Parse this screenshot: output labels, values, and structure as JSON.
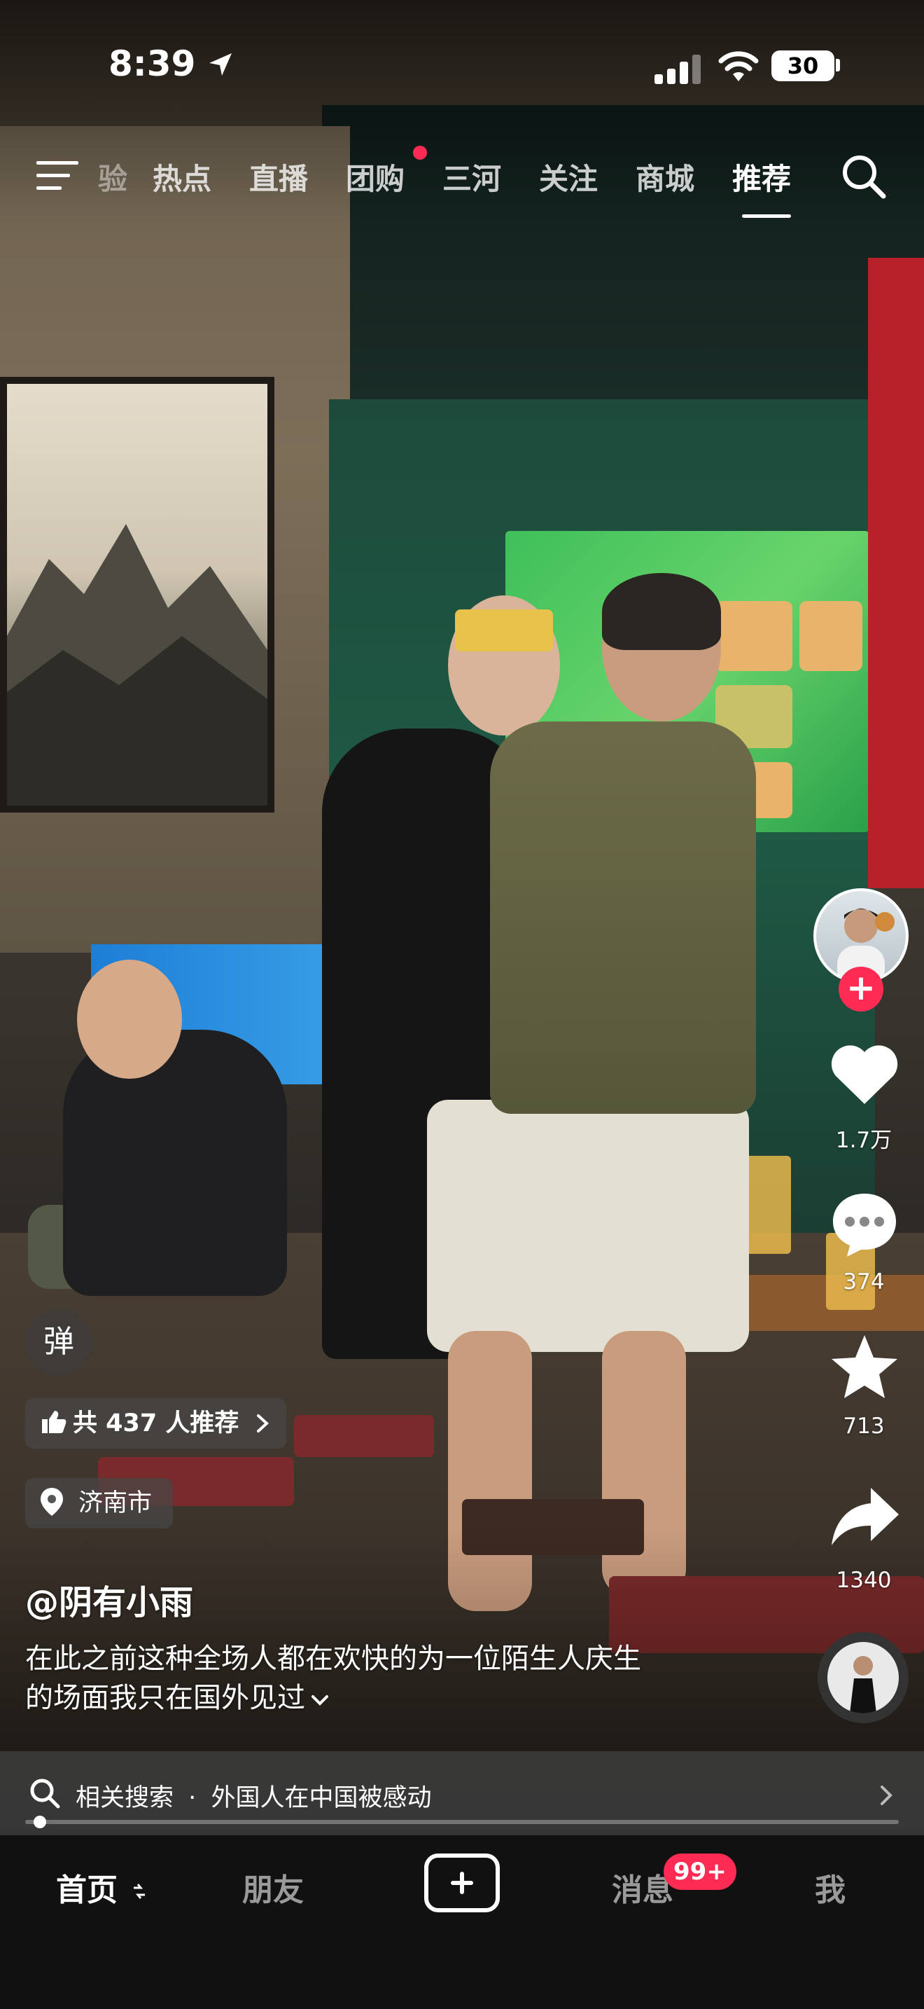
{
  "status_bar": {
    "time": "8:39",
    "battery": "30"
  },
  "top_nav": {
    "items": [
      {
        "label": "验"
      },
      {
        "label": "热点"
      },
      {
        "label": "直播"
      },
      {
        "label": "团购"
      },
      {
        "label": "三河"
      },
      {
        "label": "关注"
      },
      {
        "label": "商城"
      },
      {
        "label": "推荐",
        "active": true
      }
    ]
  },
  "actions": {
    "like_count": "1.7万",
    "comment_count": "374",
    "favorite_count": "713",
    "share_count": "1340"
  },
  "overlay": {
    "danmu_label": "弹",
    "recommend_text": "共 437 人推荐",
    "location": "济南市",
    "author": "@阴有小雨",
    "description_line1": "在此之前这种全场人都在欢快的为一位陌生人庆生",
    "description_line2": "的场面我只在国外见过"
  },
  "related_search": {
    "prefix": "相关搜索",
    "separator": "·",
    "query": "外国人在中国被感动"
  },
  "video_progress": 0.01,
  "tab_bar": {
    "home": "首页",
    "friends": "朋友",
    "messages": "消息",
    "messages_badge": "99+",
    "me": "我"
  },
  "colors": {
    "accent": "#fe2c55"
  }
}
